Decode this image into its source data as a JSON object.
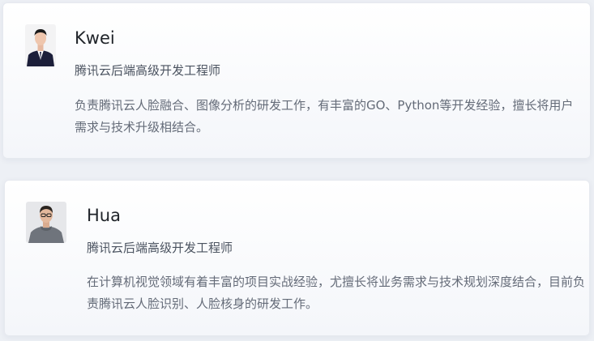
{
  "members": [
    {
      "name": "Kwei",
      "title": "腾讯云后端高级开发工程师",
      "bio": "负责腾讯云人脸融合、图像分析的研发工作，有丰富的GO、Python等开发经验，擅长将用户需求与技术升级相结合。"
    },
    {
      "name": "Hua",
      "title": "腾讯云后端高级开发工程师",
      "bio": "在计算机视觉领域有着丰富的项目实战经验，尤擅长将业务需求与技术规划深度结合，目前负责腾讯云人脸识别、人脸核身的研发工作。"
    }
  ]
}
